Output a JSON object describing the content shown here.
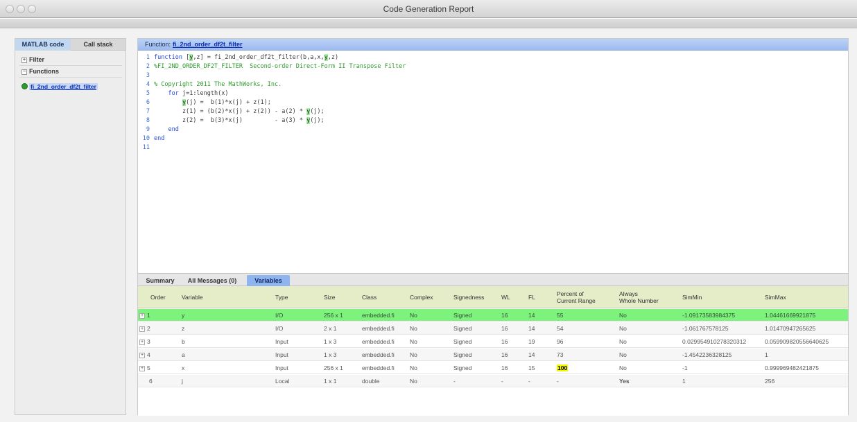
{
  "window": {
    "title": "Code Generation Report"
  },
  "left_panel": {
    "tabs": [
      {
        "label": "MATLAB code",
        "active": true
      },
      {
        "label": "Call stack",
        "active": false
      }
    ],
    "tree": {
      "filter_label": "Filter",
      "functions_label": "Functions",
      "function_item": "fi_2nd_order_df2t_filter"
    }
  },
  "main": {
    "function_header": {
      "label": "Function:",
      "link": "fi_2nd_order_df2t_filter"
    },
    "code_lines": [
      {
        "n": "1",
        "parts": [
          {
            "t": "function ",
            "c": "kw"
          },
          {
            "t": "[",
            "c": "ct"
          },
          {
            "t": "y",
            "c": "hl"
          },
          {
            "t": ",z] = fi_2nd_order_df2t_filter(b,a,x,",
            "c": "ct"
          },
          {
            "t": "y",
            "c": "hl"
          },
          {
            "t": ",z)",
            "c": "ct"
          }
        ]
      },
      {
        "n": "2",
        "parts": [
          {
            "t": "%FI_2ND_ORDER_DF2T_FILTER  Second-order Direct-Form II Transpose Filter",
            "c": "cm"
          }
        ]
      },
      {
        "n": "3",
        "parts": []
      },
      {
        "n": "4",
        "parts": [
          {
            "t": "% Copyright 2011 The MathWorks, Inc.",
            "c": "cm"
          }
        ]
      },
      {
        "n": "5",
        "parts": [
          {
            "t": "    ",
            "c": "ct"
          },
          {
            "t": "for",
            "c": "kw"
          },
          {
            "t": " j=1:length(x)",
            "c": "ct"
          }
        ]
      },
      {
        "n": "6",
        "parts": [
          {
            "t": "        ",
            "c": "ct"
          },
          {
            "t": "y",
            "c": "hl"
          },
          {
            "t": "(j) =  b(1)*x(j) + z(1);",
            "c": "ct"
          }
        ]
      },
      {
        "n": "7",
        "parts": [
          {
            "t": "        z(1) = (b(2)*x(j) + z(2)) - a(2) * ",
            "c": "ct"
          },
          {
            "t": "y",
            "c": "hl"
          },
          {
            "t": "(j);",
            "c": "ct"
          }
        ]
      },
      {
        "n": "8",
        "parts": [
          {
            "t": "        z(2) =  b(3)*x(j)         - a(3) * ",
            "c": "ct"
          },
          {
            "t": "y",
            "c": "hl"
          },
          {
            "t": "(j);",
            "c": "ct"
          }
        ]
      },
      {
        "n": "9",
        "parts": [
          {
            "t": "    ",
            "c": "ct"
          },
          {
            "t": "end",
            "c": "kw"
          }
        ]
      },
      {
        "n": "10",
        "parts": [
          {
            "t": "end",
            "c": "kw"
          }
        ]
      },
      {
        "n": "11",
        "parts": []
      }
    ],
    "bottom_tabs": [
      {
        "label": "Summary",
        "active": false
      },
      {
        "label": "All Messages (0)",
        "active": false
      },
      {
        "label": "Variables",
        "active": true
      }
    ],
    "table": {
      "headers": [
        "Order",
        "Variable",
        "Type",
        "Size",
        "Class",
        "Complex",
        "Signedness",
        "WL",
        "FL",
        "Percent of\nCurrent Range",
        "Always\nWhole Number",
        "SimMin",
        "SimMax"
      ],
      "rows": [
        {
          "expand": true,
          "order": "1",
          "variable": "y",
          "type": "I/O",
          "size": "256 x 1",
          "class": "embedded.fi",
          "complex": "No",
          "signedness": "Signed",
          "wl": "16",
          "fl": "14",
          "pct": "55",
          "pct_hl": false,
          "whole": "No",
          "simmin": "-1.09173583984375",
          "simmax": "1.04461669921875",
          "selected": true
        },
        {
          "expand": true,
          "order": "2",
          "variable": "z",
          "type": "I/O",
          "size": "2 x 1",
          "class": "embedded.fi",
          "complex": "No",
          "signedness": "Signed",
          "wl": "16",
          "fl": "14",
          "pct": "54",
          "pct_hl": false,
          "whole": "No",
          "simmin": "-1.061767578125",
          "simmax": "1.01470947265625",
          "selected": false
        },
        {
          "expand": true,
          "order": "3",
          "variable": "b",
          "type": "Input",
          "size": "1 x 3",
          "class": "embedded.fi",
          "complex": "No",
          "signedness": "Signed",
          "wl": "16",
          "fl": "19",
          "pct": "96",
          "pct_hl": false,
          "whole": "No",
          "simmin": "0.029954910278320312",
          "simmax": "0.059909820556640625",
          "selected": false
        },
        {
          "expand": true,
          "order": "4",
          "variable": "a",
          "type": "Input",
          "size": "1 x 3",
          "class": "embedded.fi",
          "complex": "No",
          "signedness": "Signed",
          "wl": "16",
          "fl": "14",
          "pct": "73",
          "pct_hl": false,
          "whole": "No",
          "simmin": "-1.4542236328125",
          "simmax": "1",
          "selected": false
        },
        {
          "expand": true,
          "order": "5",
          "variable": "x",
          "type": "Input",
          "size": "256 x 1",
          "class": "embedded.fi",
          "complex": "No",
          "signedness": "Signed",
          "wl": "16",
          "fl": "15",
          "pct": "100",
          "pct_hl": true,
          "whole": "No",
          "simmin": "-1",
          "simmax": "0.999969482421875",
          "selected": false
        },
        {
          "expand": false,
          "order": "6",
          "variable": "j",
          "type": "Local",
          "size": "1 x 1",
          "class": "double",
          "complex": "No",
          "signedness": "-",
          "wl": "-",
          "fl": "-",
          "pct": "-",
          "pct_hl": false,
          "whole": "Yes",
          "simmin": "1",
          "simmax": "256",
          "selected": false
        }
      ]
    }
  }
}
